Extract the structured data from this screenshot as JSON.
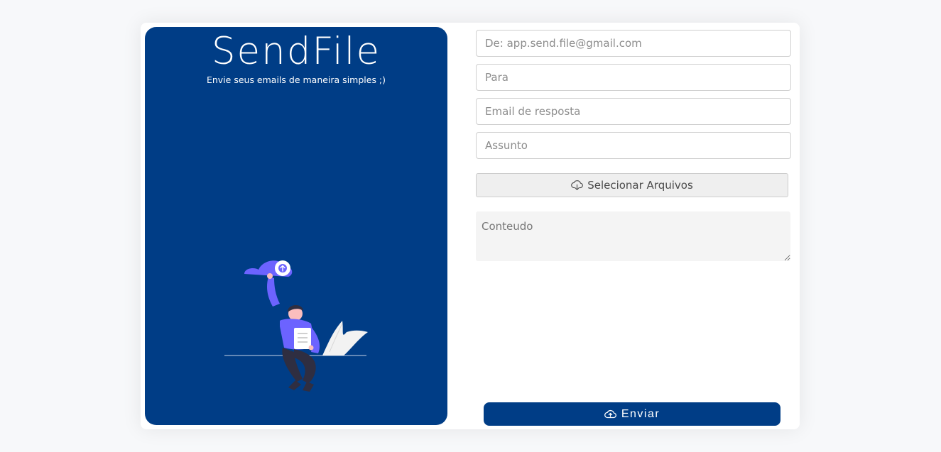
{
  "brand": {
    "title": "SendFile",
    "subtitle": "Envie seus emails de maneira simples ;)"
  },
  "form": {
    "from_placeholder": "De: app.send.file@gmail.com",
    "to_placeholder": "Para",
    "reply_placeholder": "Email de resposta",
    "subject_placeholder": "Assunto",
    "select_files_label": "Selecionar Arquivos",
    "content_placeholder": "Conteudo",
    "send_label": "Enviar"
  },
  "icons": {
    "select_files": "cloud-download-icon",
    "send": "cloud-upload-icon",
    "illustration": "person-holding-cloud-illustration"
  },
  "colors": {
    "primary": "#003d86",
    "accent": "#6c63ff",
    "page_background": "#f7f8fa",
    "field_border": "#cfcfcf",
    "select_button_bg": "#efefef",
    "textarea_bg": "#f4f4f4"
  }
}
